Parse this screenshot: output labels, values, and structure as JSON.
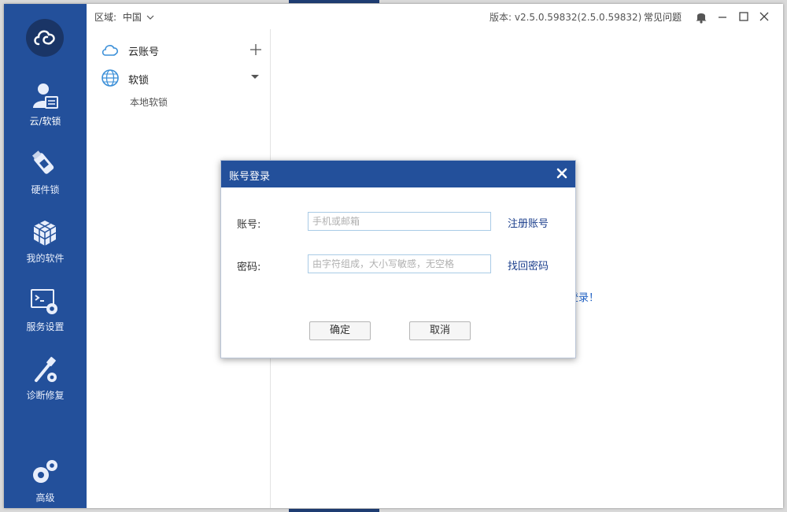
{
  "topbar": {
    "region_label": "区域:",
    "region_value": "中国",
    "version": "版本: v2.5.0.59832(2.5.0.59832)",
    "faq": "常见问题"
  },
  "nav": {
    "items": [
      {
        "label": "云/软锁",
        "icon": "user-card-icon"
      },
      {
        "label": "硬件锁",
        "icon": "usb-key-icon"
      },
      {
        "label": "我的软件",
        "icon": "cubes-icon"
      },
      {
        "label": "服务设置",
        "icon": "terminal-gear-icon"
      },
      {
        "label": "诊断修复",
        "icon": "repair-tools-icon"
      },
      {
        "label": "高级",
        "icon": "gears-icon"
      }
    ]
  },
  "tree": {
    "cloud_account": "云账号",
    "soft_lock": "软锁",
    "local_soft_lock": "本地软锁"
  },
  "main": {
    "login_link_fragment": "登录！"
  },
  "modal": {
    "title": "账号登录",
    "account_label": "账号:",
    "account_placeholder": "手机或邮箱",
    "register_link": "注册账号",
    "password_label": "密码:",
    "password_placeholder": "由字符组成，大小写敏感，无空格",
    "recover_link": "找回密码",
    "confirm_button": "确定",
    "cancel_button": "取消"
  },
  "colors": {
    "nav_bg": "#23509b",
    "modal_header": "#23509b",
    "link": "#1c3f8c",
    "input_border": "#a9cbe6"
  }
}
